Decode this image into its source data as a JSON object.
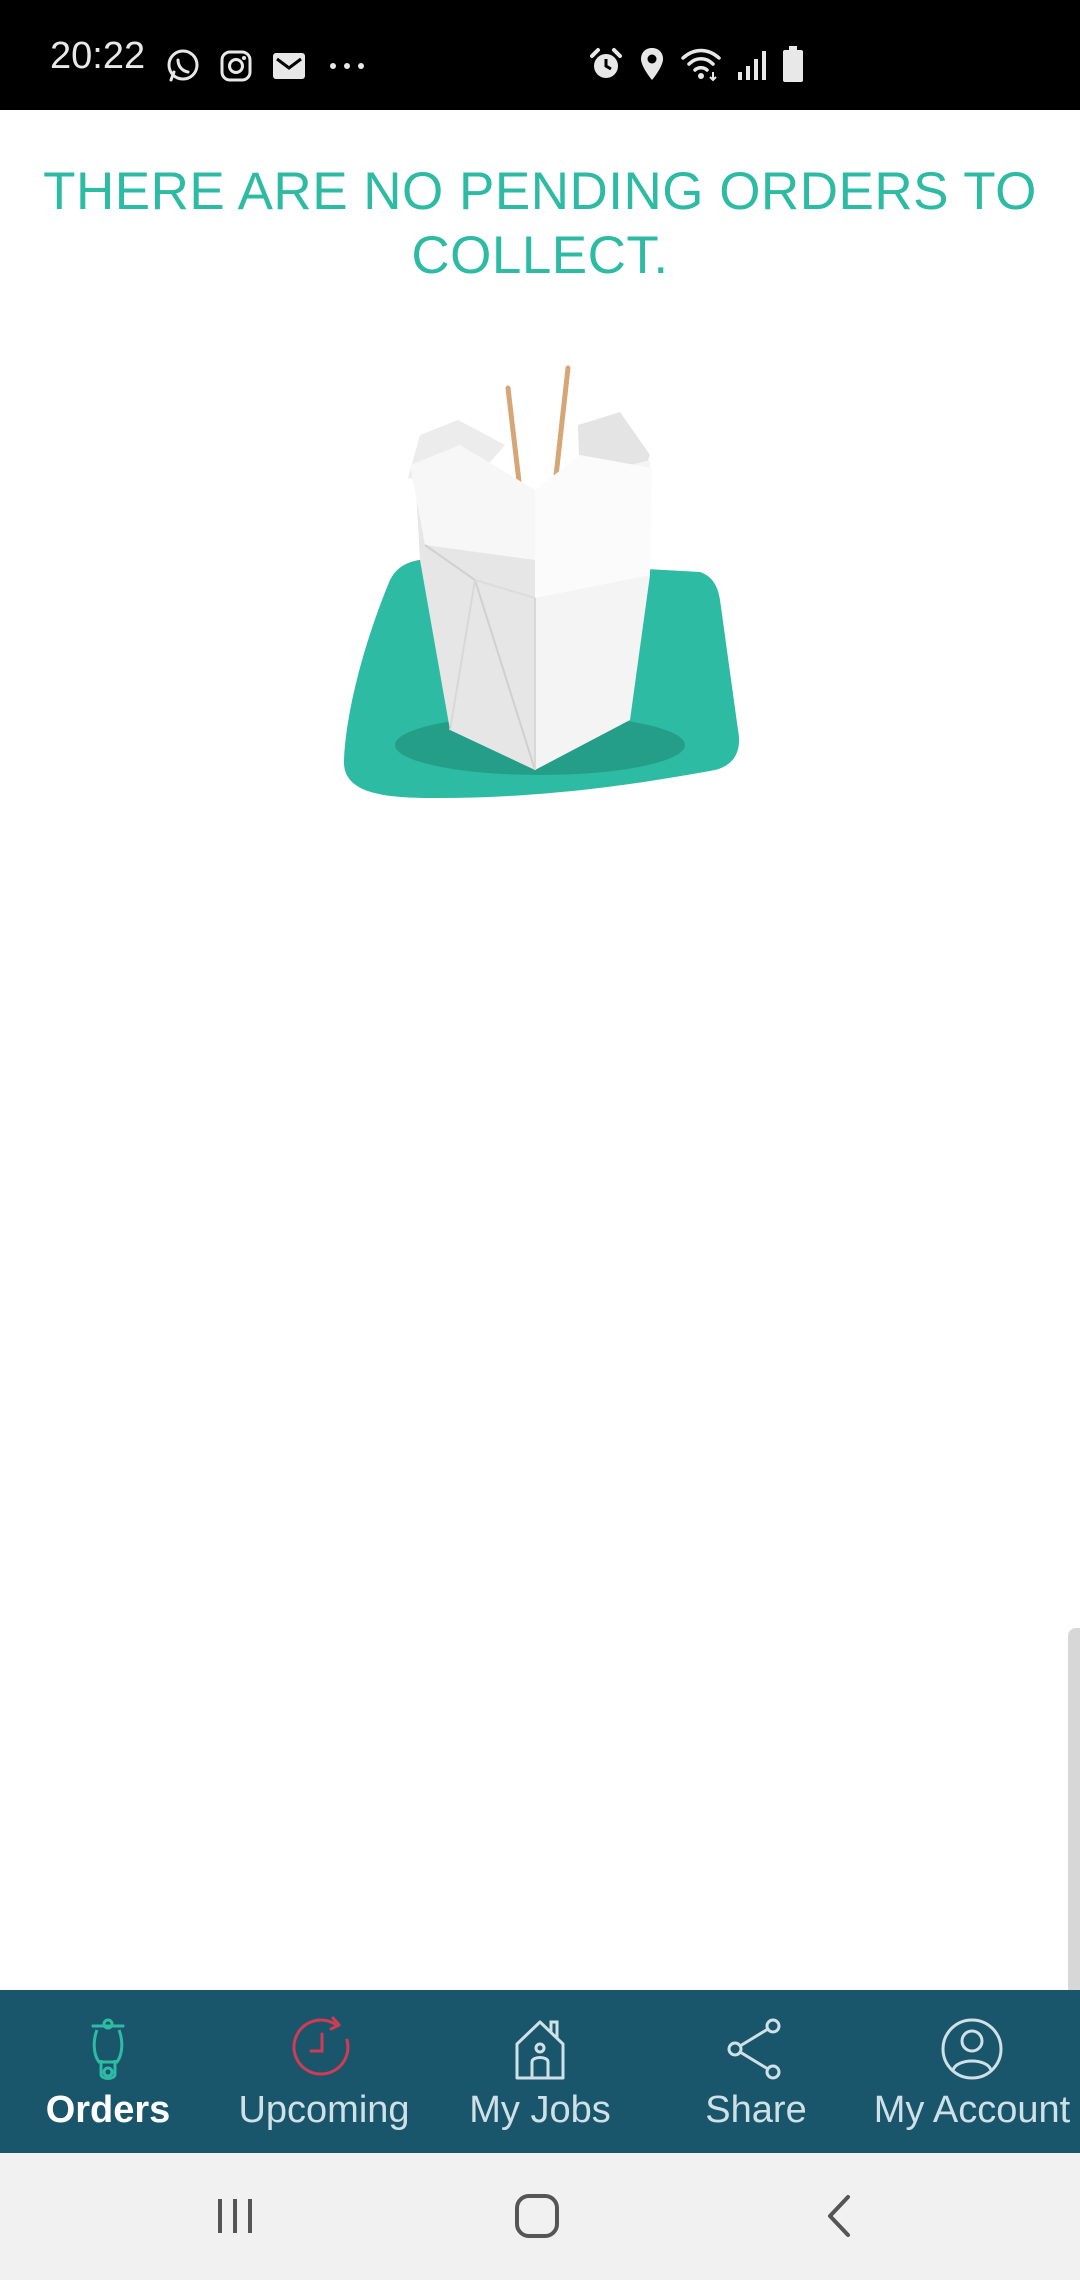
{
  "status_bar": {
    "time": "20:22",
    "left_icons": [
      "whatsapp-icon",
      "instagram-icon",
      "mail-icon",
      "more-dots-icon"
    ],
    "right_icons": [
      "alarm-icon",
      "location-icon",
      "wifi-icon",
      "signal-icon",
      "battery-icon"
    ]
  },
  "empty_state": {
    "message": "THERE ARE NO PENDING ORDERS TO COLLECT.",
    "illustration": "takeout-box-with-chopsticks"
  },
  "colors": {
    "accent": "#2ebba3",
    "nav_background": "#1a566b",
    "upcoming_icon": "#d23a55",
    "system_nav_background": "#f1f1f1"
  },
  "bottom_nav": {
    "items": [
      {
        "label": "Orders",
        "icon": "scooter-icon",
        "active": true
      },
      {
        "label": "Upcoming",
        "icon": "clock-icon",
        "active": false
      },
      {
        "label": "My Jobs",
        "icon": "house-icon",
        "active": false
      },
      {
        "label": "Share",
        "icon": "share-icon",
        "active": false
      },
      {
        "label": "My Account",
        "icon": "account-icon",
        "active": false
      }
    ]
  },
  "system_nav": {
    "buttons": [
      "recent-apps-icon",
      "home-icon",
      "back-icon"
    ]
  }
}
